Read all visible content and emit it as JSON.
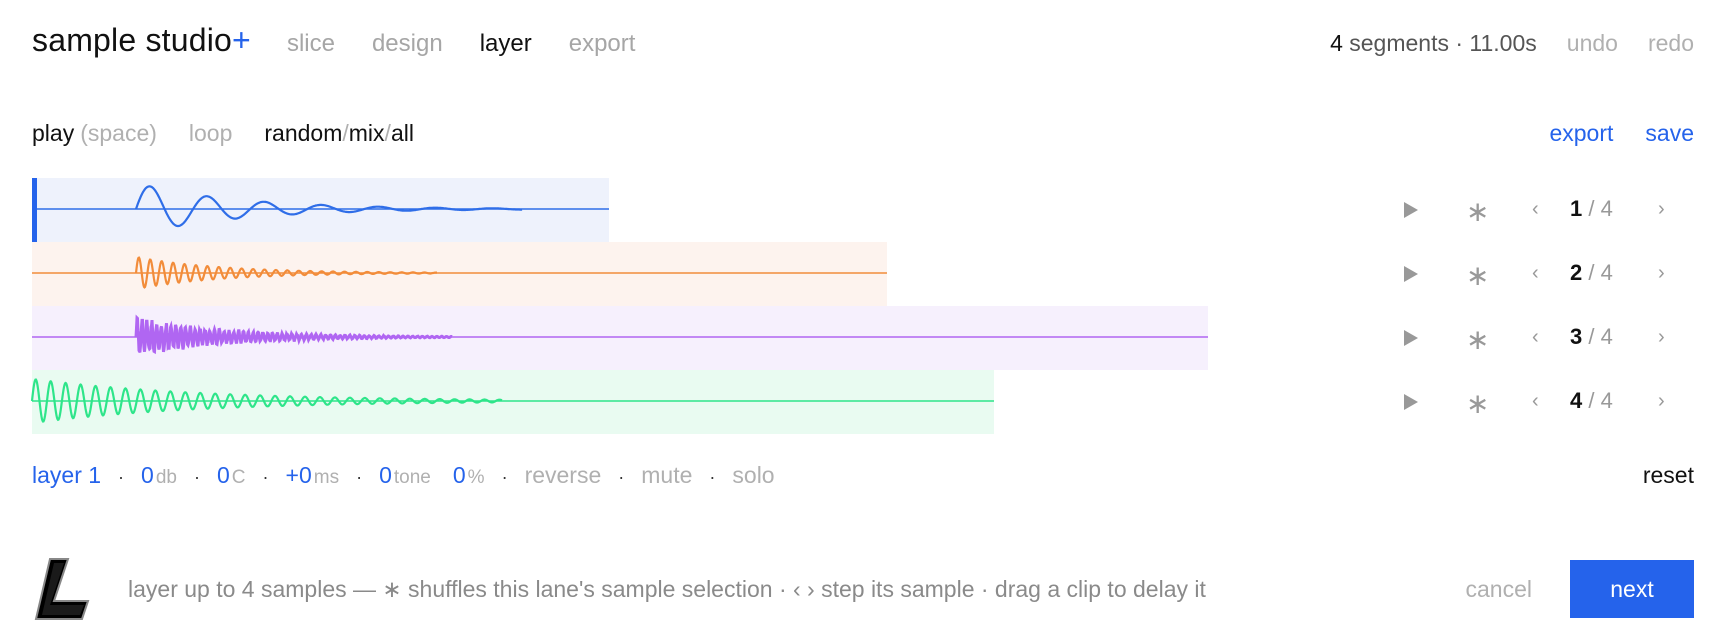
{
  "app": {
    "title": "sample studio",
    "title_plus": "+"
  },
  "nav": [
    {
      "label": "slice",
      "active": false
    },
    {
      "label": "design",
      "active": false
    },
    {
      "label": "layer",
      "active": true
    },
    {
      "label": "export",
      "active": false
    }
  ],
  "status": {
    "segments_count": "4",
    "segments_text": "segments · 11.00s",
    "undo": "undo",
    "redo": "redo"
  },
  "controls": {
    "play": "play",
    "play_hint": "(space)",
    "loop": "loop",
    "mode": [
      "random",
      "mix",
      "all"
    ],
    "mode_sep": "/",
    "export": "export",
    "save": "save"
  },
  "lanes": [
    {
      "index": "1",
      "total": "4",
      "color": "#2f6ee8",
      "bg": "#eef2fc",
      "playhead": true
    },
    {
      "index": "2",
      "total": "4",
      "color": "#f28c3a",
      "bg": "#fdf3ee",
      "playhead": false
    },
    {
      "index": "3",
      "total": "4",
      "color": "#b066f2",
      "bg": "#f6f0fd",
      "playhead": false
    },
    {
      "index": "4",
      "total": "4",
      "color": "#2ee58a",
      "bg": "#e9fbf1",
      "playhead": false
    }
  ],
  "lane_icons": {
    "play": "play-icon",
    "shuffle": "∗",
    "prev": "‹",
    "next": "›",
    "sep": "/"
  },
  "params": {
    "layer": "layer 1",
    "dot": "·",
    "gain": "0",
    "gain_unit": "db",
    "pitch": "0",
    "pitch_unit": "C",
    "delay": "+0",
    "delay_unit": "ms",
    "tone": "0",
    "tone_unit": "tone",
    "mix": "0",
    "mix_unit": "%",
    "reverse": "reverse",
    "mute": "mute",
    "solo": "solo",
    "reset": "reset"
  },
  "footer": {
    "help": "layer up to 4 samples — ∗ shuffles this lane's sample selection · ‹ › step its sample · drag a clip to delay it",
    "cancel": "cancel",
    "next": "next"
  }
}
